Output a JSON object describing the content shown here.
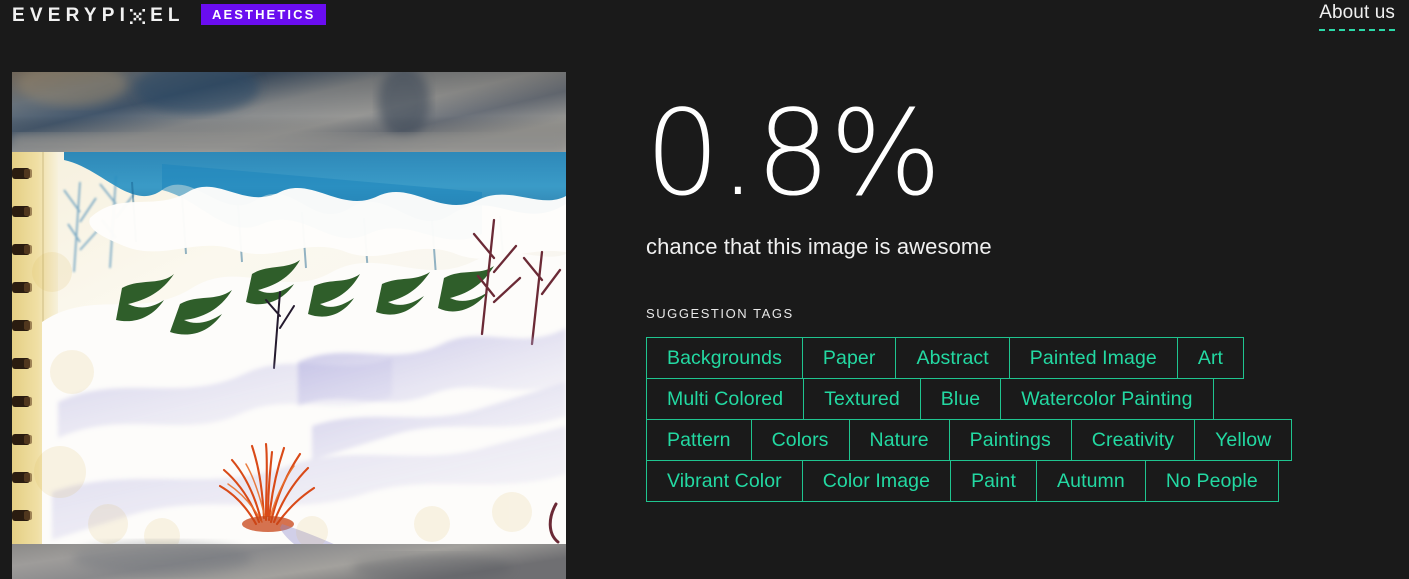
{
  "header": {
    "logo_pre": "EVERYPI",
    "logo_x_icon": "pixel-x-icon",
    "logo_post": "EL",
    "badge": "AESTHETICS",
    "about_link": "About us"
  },
  "analysis": {
    "score": "0.8%",
    "score_caption": "chance that this image is awesome",
    "tags_label": "SUGGESTION TAGS"
  },
  "tags": {
    "rows": [
      [
        "Backgrounds",
        "Paper",
        "Abstract",
        "Painted Image",
        "Art"
      ],
      [
        "Multi Colored",
        "Textured",
        "Blue",
        "Watercolor Painting"
      ],
      [
        "Pattern",
        "Colors",
        "Nature",
        "Paintings",
        "Creativity",
        "Yellow"
      ],
      [
        "Vibrant Color",
        "Color Image",
        "Paint",
        "Autumn",
        "No People"
      ]
    ]
  },
  "image": {
    "alt": "watercolor-snow-landscape-painting-in-sketchbook",
    "description": "Watercolor painting of a snowy winter landscape with blue trees, evergreen branches and orange grass on spiral-bound sketchbook paper"
  },
  "colors": {
    "background": "#1a1a1a",
    "accent_teal": "#23d9a2",
    "badge_purple": "#6a0df0",
    "text_white": "#ffffff"
  }
}
